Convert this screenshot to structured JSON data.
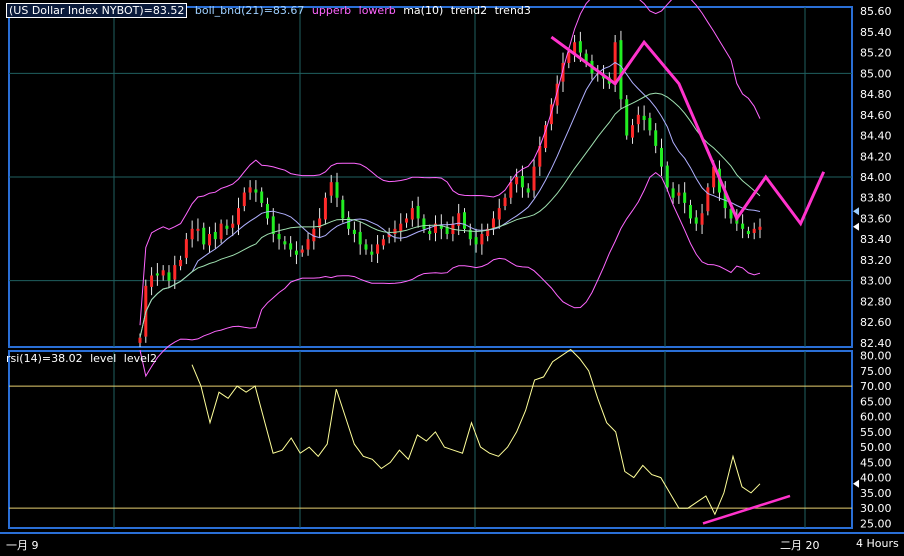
{
  "colors": {
    "background": "#000000",
    "frame": "#2a6fd6",
    "grid": "#1f5f5f",
    "up": "#ff2a2a",
    "down": "#22ee22",
    "wick": "#e8e8e8",
    "boll": "#ff66ff",
    "ma": "#b0b0ff",
    "trend": "#ff33cc",
    "rsi": "#ffff99",
    "level": "#e8d070"
  },
  "legend_top": {
    "main": "(US Dollar Index NYBOT)=83.52",
    "boll": "boll_bnd(21)=83.67",
    "upperb": "upperb",
    "lowerb": "lowerb",
    "ma": "ma(10)",
    "trend2": "trend2",
    "trend3": "trend3"
  },
  "legend_bottom": {
    "rsi": "rsi(14)=38.02",
    "level": "level",
    "level2": "level2"
  },
  "x_labels": {
    "left": "一月 9",
    "mid": "二月 20",
    "right": "4 Hours"
  },
  "chart_data": [
    {
      "type": "candlestick",
      "title": "(US Dollar Index NYBOT)=83.52",
      "y_ticks": [
        "85.60",
        "85.40",
        "85.20",
        "85.00",
        "84.80",
        "84.60",
        "84.40",
        "84.20",
        "84.00",
        "83.80",
        "83.60",
        "83.40",
        "83.20",
        "83.00",
        "82.80",
        "82.60",
        "82.40"
      ],
      "ylim": [
        82.36,
        85.64
      ],
      "grid": true,
      "last_close": 83.52,
      "boll_mid_last": 83.67,
      "close_series": [
        82.45,
        82.95,
        83.05,
        83.05,
        83.1,
        83.0,
        83.15,
        83.2,
        83.4,
        83.5,
        83.5,
        83.35,
        83.45,
        83.4,
        83.55,
        83.5,
        83.55,
        83.7,
        83.85,
        83.9,
        83.85,
        83.75,
        83.6,
        83.45,
        83.4,
        83.35,
        83.3,
        83.25,
        83.3,
        83.4,
        83.5,
        83.6,
        83.8,
        83.95,
        83.8,
        83.6,
        83.5,
        83.45,
        83.35,
        83.3,
        83.25,
        83.35,
        83.4,
        83.45,
        83.5,
        83.55,
        83.6,
        83.7,
        83.6,
        83.5,
        83.45,
        83.55,
        83.5,
        83.45,
        83.55,
        83.65,
        83.5,
        83.4,
        83.35,
        83.45,
        83.5,
        83.6,
        83.7,
        83.8,
        83.95,
        84.0,
        83.9,
        83.85,
        84.1,
        84.3,
        84.5,
        84.7,
        84.9,
        85.1,
        85.2,
        85.3,
        85.2,
        85.1,
        85.0,
        85.0,
        84.95,
        84.9,
        85.3,
        84.75,
        84.4,
        84.5,
        84.6,
        84.55,
        84.45,
        84.3,
        84.1,
        83.9,
        83.8,
        83.85,
        83.75,
        83.6,
        83.55,
        83.65,
        83.9,
        84.1,
        83.85,
        83.7,
        83.6,
        83.55,
        83.5,
        83.45,
        83.5,
        83.52
      ],
      "trend2_points": [
        [
          71,
          85.35
        ],
        [
          82,
          84.9
        ],
        [
          87,
          85.3
        ],
        [
          93,
          84.9
        ],
        [
          103,
          83.6
        ],
        [
          108,
          84.0
        ],
        [
          114,
          83.55
        ],
        [
          118,
          84.05
        ]
      ]
    },
    {
      "type": "line",
      "title": "rsi(14)=38.02",
      "y_ticks": [
        "80.00",
        "75.00",
        "70.00",
        "65.00",
        "60.00",
        "55.00",
        "50.00",
        "45.00",
        "40.00",
        "35.00",
        "30.00",
        "25.00"
      ],
      "ylim": [
        23.5,
        81.5
      ],
      "levels": [
        70,
        30
      ],
      "last": 38.02,
      "rsi_series": [
        77,
        70,
        58,
        68,
        66,
        70,
        68,
        70,
        59,
        48,
        49,
        53,
        48,
        50,
        47,
        51,
        69,
        60,
        51,
        47,
        46,
        43,
        45,
        49,
        46,
        54,
        52,
        55,
        50,
        49,
        48,
        58,
        50,
        48,
        47,
        50,
        55,
        62,
        72,
        73,
        78,
        80,
        82,
        79,
        75,
        66,
        58,
        55,
        42,
        40,
        44,
        41,
        40,
        35,
        30,
        30,
        32,
        34,
        28,
        35,
        47,
        37,
        35,
        38
      ],
      "trend_line": [
        [
          44,
          25
        ],
        [
          62,
          34
        ]
      ]
    }
  ]
}
